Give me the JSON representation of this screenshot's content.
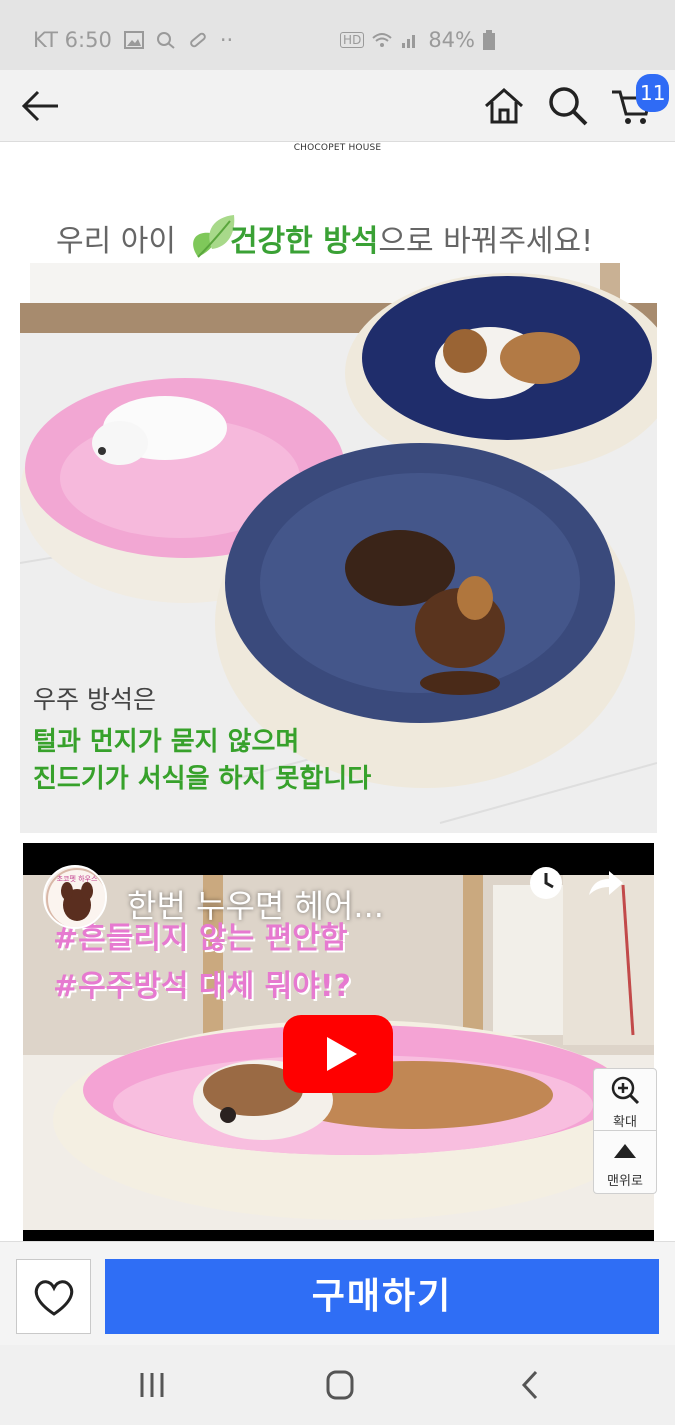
{
  "status_bar": {
    "carrier_time": "KT 6:50",
    "dots": "··",
    "hd": "HD",
    "battery": "84%"
  },
  "top_bar": {
    "cart_count": "11"
  },
  "content": {
    "brand_caption": "CHOCOPET HOUSE",
    "headline_prefix": "우리 아이",
    "headline_highlight": "건강한 방석",
    "headline_suffix": "으로 바꿔주세요!",
    "overlay_intro": "우주 방석은",
    "overlay_line1": "털과 먼지가 묻지 않으며",
    "overlay_line2": "진드기가 서식을 하지 못합니다"
  },
  "video": {
    "title": "한번 누우면 헤어...",
    "channel_name": "초코펫 하우스",
    "tag1": "#흔들리지 않는 편안함",
    "tag2": "#우주방석 대체 뭐야!?"
  },
  "side_tool": {
    "zoom_label": "확대",
    "top_label": "맨위로"
  },
  "bottom_bar": {
    "buy_label": "구매하기"
  },
  "colors": {
    "accent_blue": "#2f6ef5",
    "headline_green": "#3aa135",
    "tag_pink": "#e67ad0",
    "youtube_red": "#ff0000"
  }
}
